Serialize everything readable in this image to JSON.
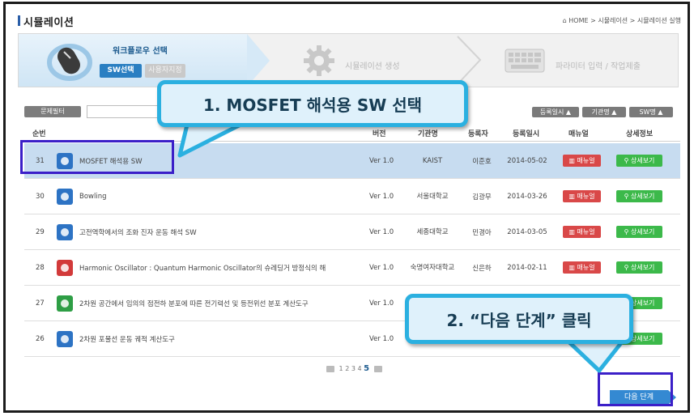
{
  "header": {
    "title": "시뮬레이션",
    "breadcrumb": "⌂ HOME > 시뮬레이션 > 시뮬레이션 실행"
  },
  "steps": {
    "step1_title": "워크플로우 선택",
    "sw_select": "SW선택",
    "user_sw": "사용자지정",
    "step2_title": "시뮬레이션 생성",
    "step3_title": "파라미터 입력 / 작업제출"
  },
  "filter": {
    "label": "문제필터",
    "value": ""
  },
  "sort": {
    "by_date": "등록일시 ▲",
    "by_inst": "기관명 ▲",
    "by_sw": "SW명 ▲"
  },
  "table": {
    "headers": {
      "num": "순번",
      "version": "버전",
      "institution": "기관명",
      "registrant": "등록자",
      "date": "등록일시",
      "manual": "매뉴얼",
      "detail": "상세정보"
    },
    "rows": [
      {
        "num": "31",
        "icon": "app-icon-blue",
        "title": "MOSFET 해석용 SW",
        "version": "Ver 1.0",
        "institution": "KAIST",
        "registrant": "이준호",
        "date": "2014-05-02"
      },
      {
        "num": "30",
        "icon": "app-icon-blue",
        "title": "Bowling",
        "version": "Ver 1.0",
        "institution": "서울대학교",
        "registrant": "김광무",
        "date": "2014-03-26"
      },
      {
        "num": "29",
        "icon": "app-icon-blue",
        "title": "고전역학에서의 조화 진자 운동 해석 SW",
        "version": "Ver 1.0",
        "institution": "세종대학교",
        "registrant": "민경아",
        "date": "2014-03-05"
      },
      {
        "num": "28",
        "icon": "app-icon-red",
        "title": "Harmonic Oscillator : Quantum Harmonic Oscillator의 슈레딩거 방정식의 해",
        "version": "Ver 1.0",
        "institution": "숙명여자대학교",
        "registrant": "신은하",
        "date": "2014-02-11"
      },
      {
        "num": "27",
        "icon": "app-icon-green",
        "title": "2차원 공간에서 임의의 점전하 분포에 따른 전기력선 및 등전위선 분포 계산도구",
        "version": "Ver 1.0",
        "institution": "",
        "registrant": "",
        "date": ""
      },
      {
        "num": "26",
        "icon": "app-icon-blue",
        "title": "2차원 포물선 운동 궤적 계산도구",
        "version": "Ver 1.0",
        "institution": "",
        "registrant": "",
        "date": ""
      }
    ],
    "manual_label": "매뉴얼",
    "detail_label": "상세보기",
    "selected_row": 0
  },
  "pagination": {
    "pages": [
      "1",
      "2",
      "3",
      "4"
    ],
    "current": "5"
  },
  "next_button": "다음 단계",
  "annotations": {
    "callout1": "1. MOSFET 해석용 SW 선택",
    "callout2": "2. “다음 단계” 클릭"
  },
  "colors": {
    "accent": "#2a7fc2",
    "selected_row": "#c7dcf0",
    "manual_btn": "#d94848",
    "detail_btn": "#3cb94a",
    "highlight_box": "#3b1fc8",
    "callout_border": "#2bb0e0"
  }
}
